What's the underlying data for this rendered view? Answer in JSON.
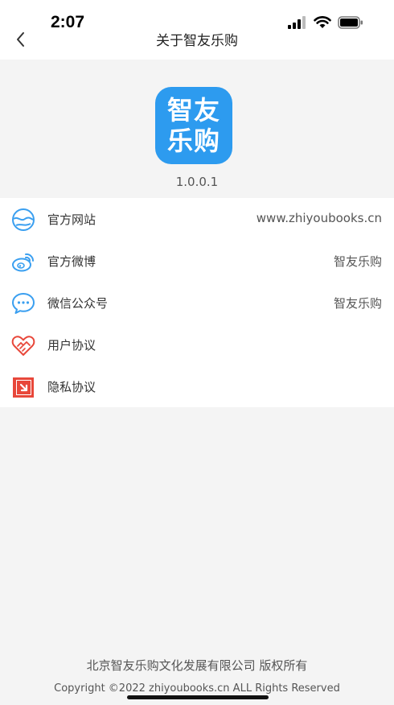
{
  "status": {
    "time": "2:07",
    "icons": [
      "signal-icon",
      "wifi-icon",
      "battery-icon"
    ]
  },
  "nav": {
    "title": "关于智友乐购",
    "back_icon": "chevron-left-icon"
  },
  "app": {
    "logo_line1": "智友",
    "logo_line2": "乐购",
    "version": "1.0.0.1",
    "logo_color": "#2d9bef"
  },
  "menu": [
    {
      "label": "官方网站",
      "value": "www.zhiyoubooks.cn",
      "icon": "website-icon"
    },
    {
      "label": "官方微博",
      "value": "智友乐购",
      "icon": "weibo-icon"
    },
    {
      "label": "微信公众号",
      "value": "智友乐购",
      "icon": "wechat-icon"
    },
    {
      "label": "用户协议",
      "value": "",
      "icon": "handshake-heart-icon"
    },
    {
      "label": "隐私协议",
      "value": "",
      "icon": "privacy-doc-icon"
    }
  ],
  "footer": {
    "company": "北京智友乐购文化发展有限公司 版权所有",
    "copyright": "Copyright ©2022 zhiyoubooks.cn ALL Rights Reserved"
  },
  "colors": {
    "accent": "#2d9bef",
    "icon_blue": "#3a9ff0",
    "icon_red": "#e8473a"
  }
}
